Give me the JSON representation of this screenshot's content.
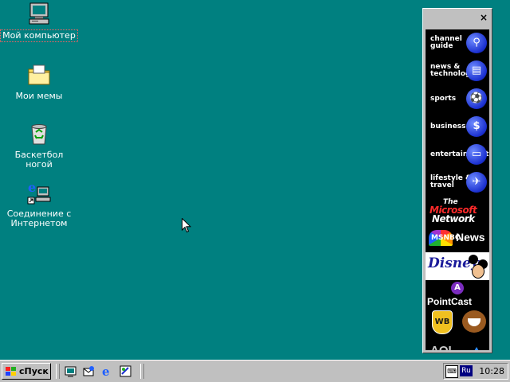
{
  "desktop": {
    "background": "#008080",
    "icons": [
      {
        "label": "Мой компьютер",
        "icon": "my-computer-icon",
        "selected": true
      },
      {
        "label": "Мои мемы",
        "icon": "folder-icon"
      },
      {
        "label": "Баскетбол ногой",
        "icon": "recycle-bin-icon"
      },
      {
        "label": "Соединение с Интернетом",
        "icon": "internet-connection-icon"
      }
    ]
  },
  "channel_bar": {
    "close_glyph": "×",
    "channels": [
      {
        "label": "channel guide",
        "icon": "magnifier-icon"
      },
      {
        "label": "news & technology",
        "icon": "newspaper-icon"
      },
      {
        "label": "sports",
        "icon": "ball-icon"
      },
      {
        "label": "business",
        "icon": "dollar-icon"
      },
      {
        "label": "entertainment",
        "icon": "tv-icon"
      },
      {
        "label": "lifestyle & travel",
        "icon": "airplane-icon"
      }
    ],
    "logos": {
      "msn_the": "The",
      "msn_microsoft": "Microsoft",
      "msn_network": "Network",
      "msnbc": "MSNBC",
      "msnbc_news": "News",
      "disney": "Disney",
      "pointcast_mark": "A",
      "pointcast": "PointCast",
      "wb": "WB",
      "aol": "AOL"
    }
  },
  "taskbar": {
    "start_label": "сПуск",
    "quick_launch": [
      "show-desktop-icon",
      "outlook-express-icon",
      "internet-explorer-icon",
      "channels-icon"
    ],
    "tray": {
      "indicator": "kbd-icon",
      "language": "Ru",
      "clock": "10:28"
    }
  }
}
